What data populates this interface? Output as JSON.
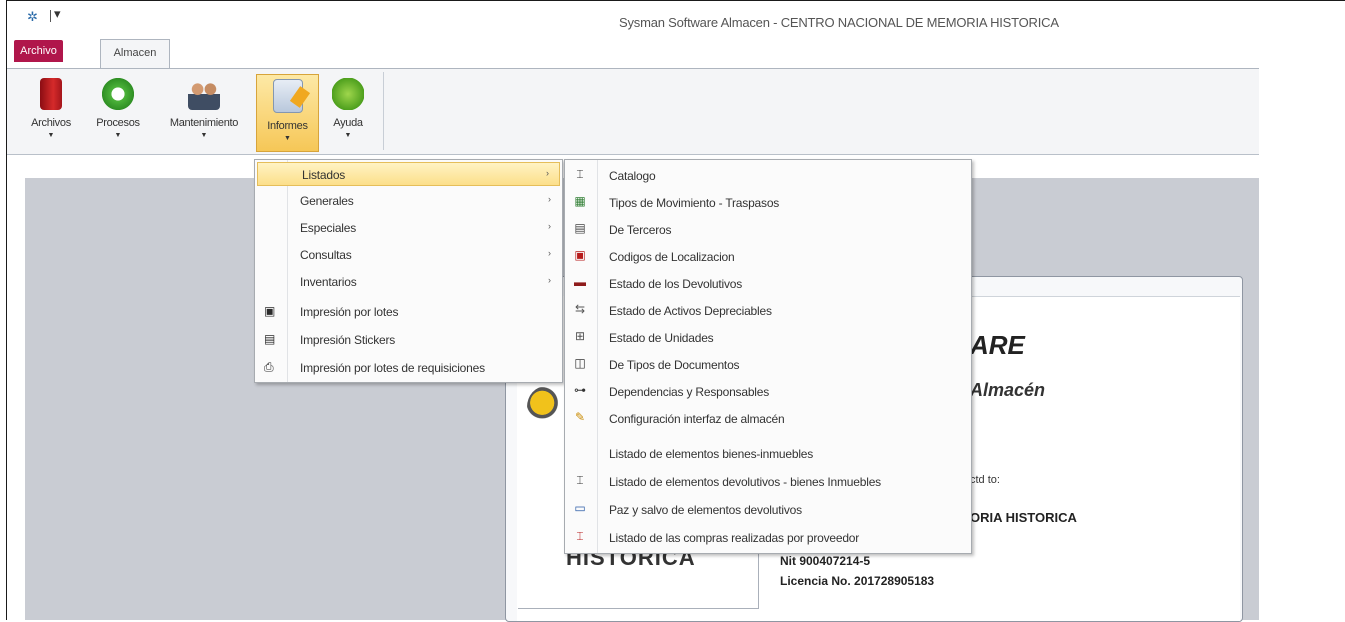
{
  "window": {
    "title": "Sysman Software Almacen - CENTRO NACIONAL DE MEMORIA HISTORICA",
    "app_icon": "app-icon",
    "quick_access": "▾"
  },
  "tabs": [
    {
      "label": "Archivo",
      "active": false,
      "color": "#b0164b"
    },
    {
      "label": "Almacen",
      "active": true
    }
  ],
  "ribbon": {
    "buttons": [
      {
        "label": "Archivos",
        "icon": "book-icon"
      },
      {
        "label": "Procesos",
        "icon": "recycle-icon"
      },
      {
        "label": "Mantenimiento",
        "icon": "people-icon"
      },
      {
        "label": "Informes",
        "icon": "report-icon",
        "active": true
      },
      {
        "label": "Ayuda",
        "icon": "help-icon"
      }
    ],
    "dropdown_glyph": "▼"
  },
  "informes_menu": {
    "items": [
      {
        "label": "Listados",
        "has_submenu": true,
        "highlighted": true
      },
      {
        "label": "Generales",
        "has_submenu": true
      },
      {
        "label": "Especiales",
        "has_submenu": true
      },
      {
        "label": "Consultas",
        "has_submenu": true
      },
      {
        "label": "Inventarios",
        "has_submenu": true
      },
      {
        "label": "Impresión por lotes",
        "icon": "print-lot-icon"
      },
      {
        "label": "Impresión Stickers",
        "icon": "sticker-icon"
      },
      {
        "label": "Impresión por lotes de requisiciones",
        "icon": "print-requisition-icon"
      }
    ],
    "arrow": "›"
  },
  "listados_submenu": {
    "items": [
      {
        "label": "Catalogo",
        "icon": "catalog-icon",
        "glyph": "⌶"
      },
      {
        "label": "Tipos de Movimiento - Traspasos",
        "icon": "movement-icon",
        "glyph": "▦"
      },
      {
        "label": "De Terceros",
        "icon": "third-party-icon",
        "glyph": "▤"
      },
      {
        "label": "Codigos de Localizacion",
        "icon": "location-icon",
        "glyph": "▣"
      },
      {
        "label": "Estado de los Devolutivos",
        "icon": "status-icon",
        "glyph": "▬"
      },
      {
        "label": "Estado de Activos Depreciables",
        "icon": "assets-icon",
        "glyph": "⇆"
      },
      {
        "label": "Estado de Unidades",
        "icon": "units-icon",
        "glyph": "⊞"
      },
      {
        "label": "De Tipos de Documentos",
        "icon": "document-types-icon",
        "glyph": "◫"
      },
      {
        "label": "Dependencias y Responsables",
        "icon": "dependencies-icon",
        "glyph": "⊶"
      },
      {
        "label": "Configuración interfaz de almacén",
        "icon": "config-icon",
        "glyph": "✎"
      },
      {
        "label": "Listado de elementos bienes-inmuebles",
        "icon": "",
        "glyph": ""
      },
      {
        "label": "Listado de elementos devolutivos - bienes Inmuebles",
        "icon": "list-devolutive-icon",
        "glyph": "⌶"
      },
      {
        "label": "Paz y salvo de elementos devolutivos",
        "icon": "clearance-icon",
        "glyph": "▭"
      },
      {
        "label": "Listado de las compras realizadas por proveedor",
        "icon": "purchases-icon",
        "glyph": "⌶"
      }
    ]
  },
  "splash": {
    "title": "ARE",
    "subtitle": "Almacén",
    "licensed_to": "ctd to:",
    "client": "ORIA HISTORICA",
    "logo_text": "HISTORICA",
    "nit": "Nit 900407214-5",
    "licencia": "Licencia No. 201728905183"
  },
  "colors": {
    "accent_tab": "#b0164b",
    "workspace": "#c9ccd3",
    "menu_highlight": "#fcdf8a"
  }
}
